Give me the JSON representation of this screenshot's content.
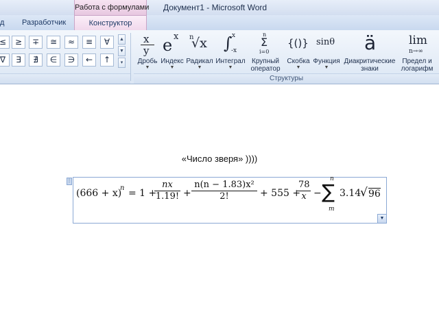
{
  "titlebar": {
    "context_tab": "Работа с формулами",
    "window_title": "Документ1 - Microsoft Word"
  },
  "tabs": {
    "partial_tab": "д",
    "developer": "Разработчик",
    "constructor": "Конструктор"
  },
  "ribbon": {
    "symbols_row1": [
      "≤",
      "≥",
      "∓",
      "≅",
      "≈",
      "≡",
      "∀"
    ],
    "symbols_row2": [
      "∇",
      "∃",
      "∄",
      "∈",
      "∋",
      "←",
      "↑"
    ],
    "structures": [
      {
        "label": "Дробь",
        "icon": "fraction-icon"
      },
      {
        "label": "Индекс",
        "icon": "script-icon"
      },
      {
        "label": "Радикал",
        "icon": "radical-icon"
      },
      {
        "label": "Интеграл",
        "icon": "integral-icon"
      },
      {
        "label": "Крупный",
        "label2": "оператор",
        "icon": "large-operator-icon"
      },
      {
        "label": "Скобка",
        "icon": "bracket-icon"
      },
      {
        "label": "Функция",
        "icon": "function-icon"
      },
      {
        "label": "Диакритические",
        "label2": "знаки",
        "icon": "accent-icon"
      },
      {
        "label": "Предел и",
        "label2": "логарифм",
        "icon": "limit-icon"
      }
    ],
    "icon_text": {
      "frac_num": "x",
      "frac_den": "y",
      "exp_base": "e",
      "exp_sup": "x",
      "rad_index": "n",
      "rad_body": "√x",
      "int_sign": "∫",
      "int_sup": "x",
      "int_sub": "-x",
      "sum_sup": "n",
      "sum_sign": "Σ",
      "sum_sub": "i=0",
      "bracket": "{()}",
      "func": "sinθ",
      "accent": "ä",
      "lim": "lim",
      "lim_sub": "n→∞"
    },
    "group_label": "Структуры"
  },
  "document": {
    "text": "«Число зверя» ))))",
    "equation": {
      "lhs": "(666 + x)",
      "lhs_exp": "n",
      "eq_part": "= 1 +",
      "frac1_num": "nx",
      "frac1_den": "1.19!",
      "plus1": "+",
      "frac2_num": "n(n − 1.83)x²",
      "frac2_den": "2!",
      "plus2": "+ 555 +",
      "frac3_num": "78",
      "frac3_den": "x",
      "minus": "−",
      "sum_sign": "∑",
      "sum_sup": "n",
      "sum_sub": "m",
      "tail": "3.14",
      "sqrt_sign": "√",
      "sqrt_body": "96"
    }
  }
}
